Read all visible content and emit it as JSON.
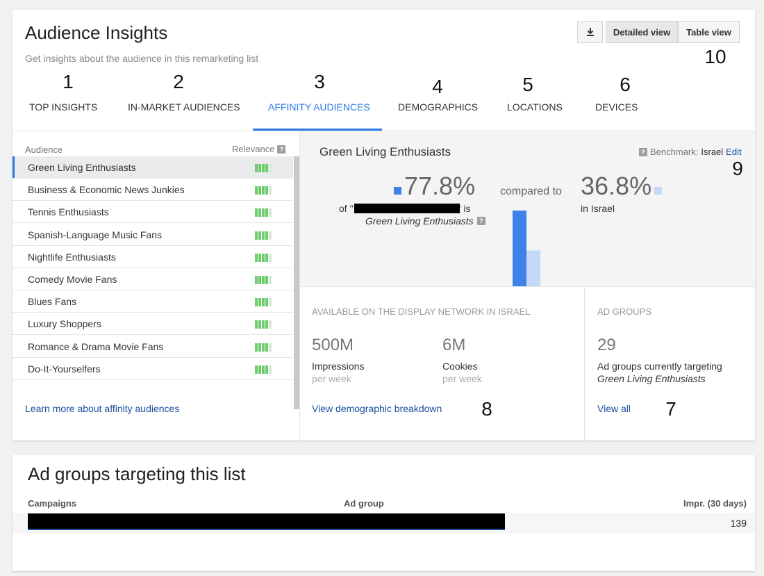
{
  "header": {
    "title": "Audience Insights",
    "subtitle": "Get insights about the audience in this remarketing list",
    "download_icon": "download-icon",
    "detailed_view_label": "Detailed view",
    "table_view_label": "Table view",
    "callout_10": "10"
  },
  "tabs": [
    {
      "num": "1",
      "label": "TOP INSIGHTS"
    },
    {
      "num": "2",
      "label": "IN-MARKET AUDIENCES"
    },
    {
      "num": "3",
      "label": "AFFINITY AUDIENCES"
    },
    {
      "num": "4",
      "label": "DEMOGRAPHICS"
    },
    {
      "num": "5",
      "label": "LOCATIONS"
    },
    {
      "num": "6",
      "label": "DEVICES"
    }
  ],
  "audience_list": {
    "col_audience": "Audience",
    "col_relevance": "Relevance",
    "help_mark": "?",
    "items": [
      {
        "name": "Green Living Enthusiasts",
        "relevance": 4
      },
      {
        "name": "Business & Economic News Junkies",
        "relevance": 4
      },
      {
        "name": "Tennis Enthusiasts",
        "relevance": 4
      },
      {
        "name": "Spanish-Language Music Fans",
        "relevance": 4
      },
      {
        "name": "Nightlife Enthusiasts",
        "relevance": 4
      },
      {
        "name": "Comedy Movie Fans",
        "relevance": 4
      },
      {
        "name": "Blues Fans",
        "relevance": 4
      },
      {
        "name": "Luxury Shoppers",
        "relevance": 4
      },
      {
        "name": "Romance & Drama Movie Fans",
        "relevance": 4
      },
      {
        "name": "Do-It-Yourselfers",
        "relevance": 4
      }
    ],
    "learn_more": "Learn more about affinity audiences"
  },
  "detail": {
    "title": "Green Living Enthusiasts",
    "benchmark_label": "Benchmark:",
    "benchmark_value": "Israel",
    "edit_label": "Edit",
    "callout_9": "9",
    "list_pct": "77.8%",
    "of_prefix": "of \"",
    "is_suffix": "\" is",
    "list_audience": "Green Living Enthusiasts",
    "compared_to": "compared to",
    "bench_pct": "36.8%",
    "in_location": "in Israel",
    "colors": {
      "primary": "#3d82e8",
      "light": "#c5d9f6"
    },
    "chart_data": {
      "type": "bar",
      "categories": [
        "remarketing list",
        "Israel"
      ],
      "values": [
        77.8,
        36.8
      ],
      "ylim": [
        0,
        100
      ]
    }
  },
  "display_network": {
    "heading": "AVAILABLE ON THE DISPLAY NETWORK IN ISRAEL",
    "impressions_value": "500M",
    "impressions_label": "Impressions",
    "impressions_sub": "per week",
    "cookies_value": "6M",
    "cookies_label": "Cookies",
    "cookies_sub": "per week",
    "link": "View demographic breakdown",
    "callout_8": "8"
  },
  "ad_groups_box": {
    "heading": "AD GROUPS",
    "value": "29",
    "label": "Ad groups currently targeting",
    "audience": "Green Living Enthusiasts",
    "link": "View all",
    "callout_7": "7"
  },
  "ad_groups_table": {
    "title": "Ad groups targeting this list",
    "col_campaigns": "Campaigns",
    "col_adgroup": "Ad group",
    "col_impr": "Impr. (30 days)",
    "rows": [
      {
        "impr": "139"
      }
    ]
  }
}
